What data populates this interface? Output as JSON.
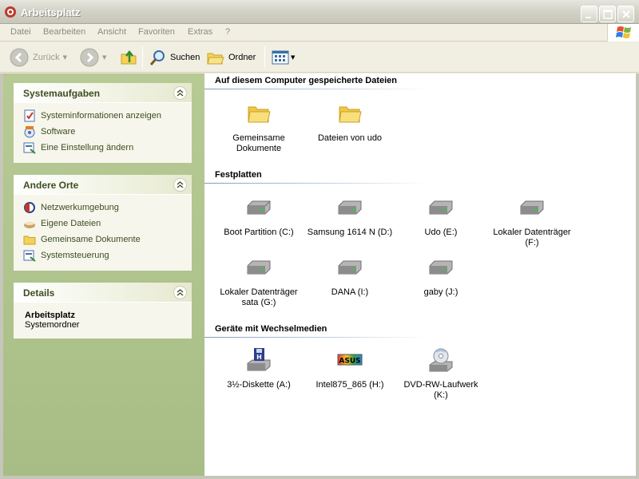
{
  "window": {
    "title": "Arbeitsplatz"
  },
  "menu": [
    "Datei",
    "Bearbeiten",
    "Ansicht",
    "Favoriten",
    "Extras",
    "?"
  ],
  "toolbar": {
    "back_label": "Zurück",
    "search_label": "Suchen",
    "folders_label": "Ordner"
  },
  "sidebar": {
    "system_tasks": {
      "title": "Systemaufgaben",
      "items": [
        {
          "label": "Systeminformationen anzeigen",
          "icon": "system-info-icon"
        },
        {
          "label": "Software",
          "icon": "software-icon"
        },
        {
          "label": "Eine Einstellung ändern",
          "icon": "settings-icon"
        }
      ]
    },
    "other_places": {
      "title": "Andere Orte",
      "items": [
        {
          "label": "Netzwerkumgebung",
          "icon": "network-icon"
        },
        {
          "label": "Eigene Dateien",
          "icon": "my-documents-icon"
        },
        {
          "label": "Gemeinsame Dokumente",
          "icon": "folder-icon"
        },
        {
          "label": "Systemsteuerung",
          "icon": "control-panel-icon"
        }
      ]
    },
    "details": {
      "title": "Details",
      "name": "Arbeitsplatz",
      "type": "Systemordner"
    }
  },
  "content": {
    "sections": [
      {
        "title": "Auf diesem Computer gespeicherte Dateien",
        "items": [
          {
            "label": "Gemeinsame Dokumente",
            "icon": "folder-icon"
          },
          {
            "label": "Dateien von udo",
            "icon": "folder-icon"
          }
        ]
      },
      {
        "title": "Festplatten",
        "items": [
          {
            "label": "Boot Partition (C:)",
            "icon": "hard-drive-icon"
          },
          {
            "label": "Samsung 1614 N (D:)",
            "icon": "hard-drive-icon"
          },
          {
            "label": "Udo (E:)",
            "icon": "hard-drive-icon"
          },
          {
            "label": "Lokaler Datenträger (F:)",
            "icon": "hard-drive-icon"
          },
          {
            "label": "Lokaler Datenträger sata (G:)",
            "icon": "hard-drive-icon"
          },
          {
            "label": "DANA (I:)",
            "icon": "hard-drive-icon"
          },
          {
            "label": "gaby (J:)",
            "icon": "hard-drive-icon"
          }
        ]
      },
      {
        "title": "Geräte mit Wechselmedien",
        "items": [
          {
            "label": "3½-Diskette (A:)",
            "icon": "floppy-drive-icon"
          },
          {
            "label": "Intel875_865 (H:)",
            "icon": "asus-drive-icon"
          },
          {
            "label": "DVD-RW-Laufwerk (K:)",
            "icon": "dvd-drive-icon"
          }
        ]
      }
    ],
    "asus_logo_text": "ASUS"
  }
}
